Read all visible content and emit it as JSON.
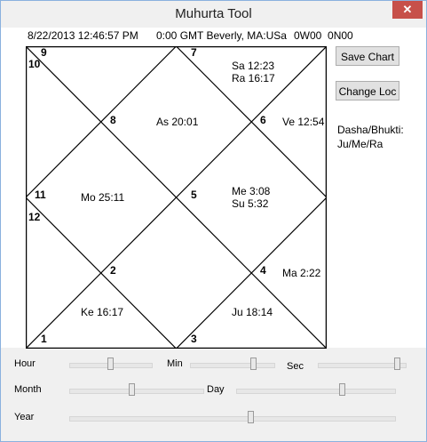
{
  "window": {
    "title": "Muhurta Tool",
    "close_glyph": "✕"
  },
  "info": {
    "datetime": "8/22/2013 12:46:57 PM",
    "location": "0:00 GMT Beverly, MA:USa",
    "coords": "0W00  0N00"
  },
  "chart": {
    "houses": [
      "1",
      "2",
      "3",
      "4",
      "5",
      "6",
      "7",
      "8",
      "9",
      "10",
      "11",
      "12"
    ],
    "planets": {
      "as": "As 20:01",
      "sa": "Sa 12:23",
      "ra": "Ra 16:17",
      "ve": "Ve 12:54",
      "mo": "Mo 25:11",
      "me": "Me 3:08",
      "su": "Su 5:32",
      "ma": "Ma 2:22",
      "ke": "Ke 16:17",
      "ju": "Ju 18:14"
    }
  },
  "buttons": {
    "save_chart": "Save Chart",
    "change_loc": "Change Loc"
  },
  "dasha": {
    "label": "Dasha/Bhukti:",
    "value": "Ju/Me/Ra"
  },
  "sliders": {
    "hour": {
      "label": "Hour",
      "value": 0.5
    },
    "min": {
      "label": "Min",
      "value": 0.78
    },
    "sec": {
      "label": "Sec",
      "value": 0.95
    },
    "month": {
      "label": "Month",
      "value": 0.47
    },
    "day": {
      "label": "Day",
      "value": 0.68
    },
    "year": {
      "label": "Year",
      "value": 0.56
    }
  },
  "colors": {
    "close": "#c7504a",
    "border": "#8ab1de"
  }
}
